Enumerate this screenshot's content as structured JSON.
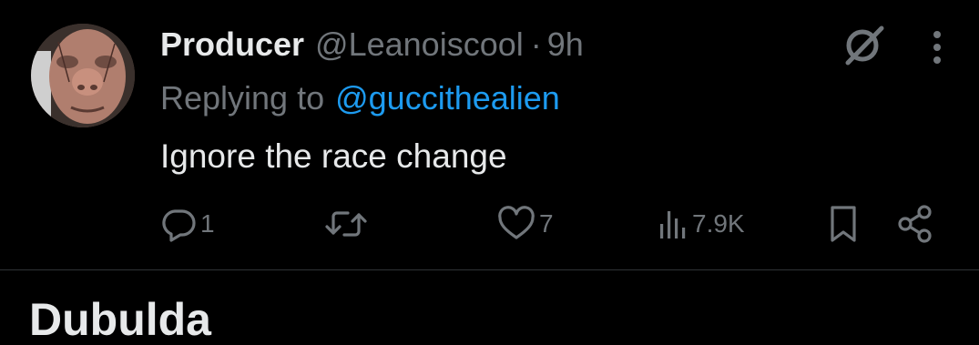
{
  "tweet": {
    "display_name": "Producer",
    "handle": "@Leanoiscool",
    "separator": "·",
    "time": "9h",
    "replying_to_label": "Replying to",
    "replying_to_handle": "@guccithealien",
    "text": "Ignore the race change",
    "avatar": "avatar-photo"
  },
  "icons": {
    "grok": "grok-icon",
    "more": "more-vertical-icon",
    "reply": "reply-icon",
    "retweet": "retweet-icon",
    "like": "heart-icon",
    "views": "views-chart-icon",
    "bookmark": "bookmark-icon",
    "share": "share-icon"
  },
  "actions": {
    "reply_count": "1",
    "retweet_count": "",
    "like_count": "7",
    "view_count": "7.9K"
  },
  "next_section": {
    "heading": "Dubulda"
  },
  "colors": {
    "background": "#000000",
    "primary_text": "#e7e9ea",
    "secondary_text": "#71767b",
    "link": "#1d9bf0",
    "divider": "#2f3336"
  }
}
